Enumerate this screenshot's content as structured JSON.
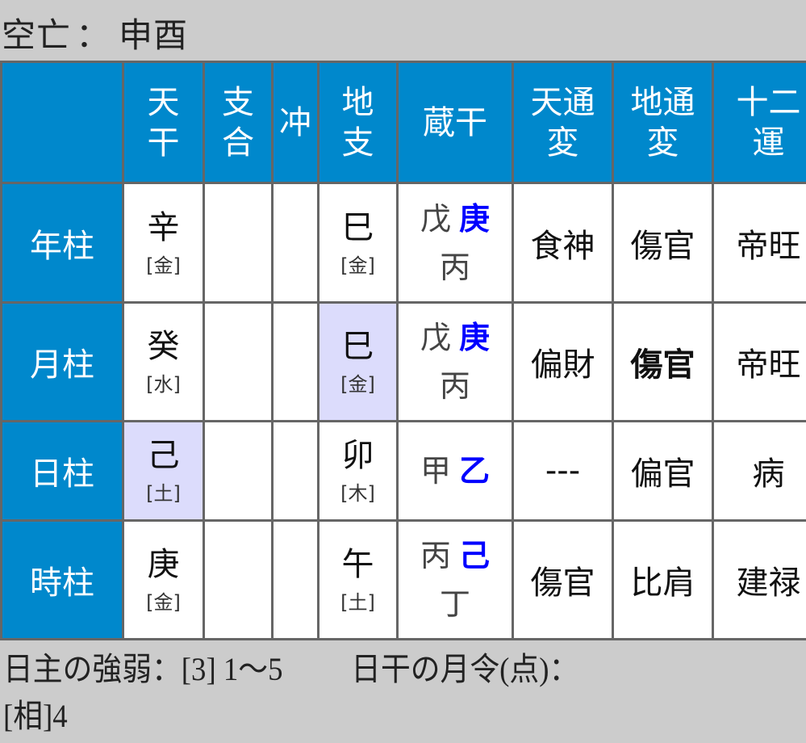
{
  "kubou": {
    "label": "空亡",
    "colon": "：",
    "value": "申酉"
  },
  "colors": {
    "header_bg": "#0088cc",
    "border": "#666666",
    "highlight_bg": "#dcdcfc",
    "main_hidden_stem": "#0000ff",
    "page_bg": "#cccccc"
  },
  "table": {
    "headers": [
      {
        "line1": "",
        "line2": ""
      },
      {
        "line1": "天",
        "line2": "干"
      },
      {
        "line1": "支",
        "line2": "合"
      },
      {
        "line1": "冲",
        "line2": ""
      },
      {
        "line1": "地",
        "line2": "支"
      },
      {
        "line1": "蔵干",
        "line2": ""
      },
      {
        "line1": "天通",
        "line2": "変"
      },
      {
        "line1": "地通",
        "line2": "変"
      },
      {
        "line1": "十二",
        "line2": "運"
      }
    ],
    "rows": [
      {
        "label": "年柱",
        "tenkan": "辛",
        "tenkan_element": "[金]",
        "shigo": "",
        "chu": "",
        "chishi": "巳",
        "chishi_element": "[金]",
        "zokan_first": "戊",
        "zokan_main": "庚",
        "zokan_second": "丙",
        "tentsuhen": "食神",
        "chitsuhen": "傷官",
        "juniun": "帝旺"
      },
      {
        "label": "月柱",
        "tenkan": "癸",
        "tenkan_element": "[水]",
        "shigo": "",
        "chu": "",
        "chishi": "巳",
        "chishi_element": "[金]",
        "zokan_first": "戊",
        "zokan_main": "庚",
        "zokan_second": "丙",
        "tentsuhen": "偏財",
        "chitsuhen": "傷官",
        "juniun": "帝旺"
      },
      {
        "label": "日柱",
        "tenkan": "己",
        "tenkan_element": "[土]",
        "shigo": "",
        "chu": "",
        "chishi": "卯",
        "chishi_element": "[木]",
        "zokan_first": "甲",
        "zokan_main": "乙",
        "zokan_second": "",
        "tentsuhen": "---",
        "chitsuhen": "偏官",
        "juniun": "病"
      },
      {
        "label": "時柱",
        "tenkan": "庚",
        "tenkan_element": "[金]",
        "shigo": "",
        "chu": "",
        "chishi": "午",
        "chishi_element": "[土]",
        "zokan_first": "丙",
        "zokan_main": "己",
        "zokan_second": "丁",
        "tentsuhen": "傷官",
        "chitsuhen": "比肩",
        "juniun": "建禄"
      }
    ]
  },
  "footer": {
    "strength_label": "日主の強弱：",
    "strength_value": "[3] 1〜5",
    "monthly_label": "日干の月令(点)：",
    "monthly_value": "[相]4"
  }
}
